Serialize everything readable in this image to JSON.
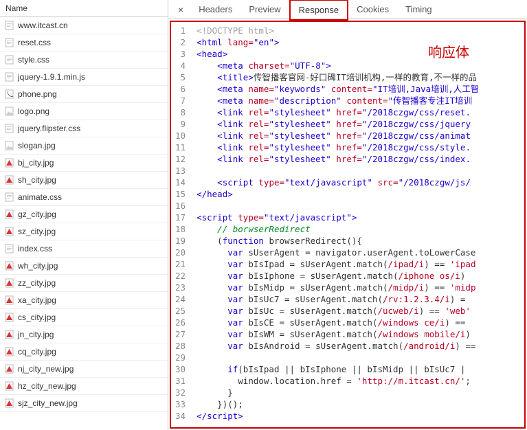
{
  "left": {
    "header": "Name",
    "files": [
      {
        "name": "www.itcast.cn",
        "type": "doc"
      },
      {
        "name": "reset.css",
        "type": "css"
      },
      {
        "name": "style.css",
        "type": "css"
      },
      {
        "name": "jquery-1.9.1.min.js",
        "type": "js"
      },
      {
        "name": "phone.png",
        "type": "png-phone"
      },
      {
        "name": "logo.png",
        "type": "png"
      },
      {
        "name": "jquery.flipster.css",
        "type": "css"
      },
      {
        "name": "slogan.jpg",
        "type": "jpg"
      },
      {
        "name": "bj_city.jpg",
        "type": "jpg-warn"
      },
      {
        "name": "sh_city.jpg",
        "type": "jpg-warn"
      },
      {
        "name": "animate.css",
        "type": "css"
      },
      {
        "name": "gz_city.jpg",
        "type": "jpg-warn"
      },
      {
        "name": "sz_city.jpg",
        "type": "jpg-warn"
      },
      {
        "name": "index.css",
        "type": "css"
      },
      {
        "name": "wh_city.jpg",
        "type": "jpg-warn"
      },
      {
        "name": "zz_city.jpg",
        "type": "jpg-warn"
      },
      {
        "name": "xa_city.jpg",
        "type": "jpg-warn"
      },
      {
        "name": "cs_city.jpg",
        "type": "jpg-warn"
      },
      {
        "name": "jn_city.jpg",
        "type": "jpg-warn"
      },
      {
        "name": "cq_city.jpg",
        "type": "jpg-warn"
      },
      {
        "name": "nj_city_new.jpg",
        "type": "jpg-warn"
      },
      {
        "name": "hz_city_new.jpg",
        "type": "jpg-warn"
      },
      {
        "name": "sjz_city_new.jpg",
        "type": "jpg-warn"
      }
    ]
  },
  "tabs": {
    "items": [
      "Headers",
      "Preview",
      "Response",
      "Cookies",
      "Timing"
    ],
    "active": "Response",
    "close": "×"
  },
  "annotation": "响应体",
  "code": {
    "lines": [
      {
        "n": 1,
        "html": "<span class='c-gray'>&lt;!DOCTYPE html&gt;</span>"
      },
      {
        "n": 2,
        "html": "<span class='c-blue'>&lt;html</span> <span class='c-red'>lang=</span><span class='c-blue'>\"en\"</span><span class='c-blue'>&gt;</span>"
      },
      {
        "n": 3,
        "html": "<span class='c-blue'>&lt;head&gt;</span>"
      },
      {
        "n": 4,
        "html": "    <span class='c-blue'>&lt;meta</span> <span class='c-red'>charset=</span><span class='c-blue'>\"UTF-8\"</span><span class='c-blue'>&gt;</span>"
      },
      {
        "n": 5,
        "html": "    <span class='c-blue'>&lt;title&gt;</span>传智播客官网-好口碑IT培训机构,一样的教育,不一样的品"
      },
      {
        "n": 6,
        "html": "    <span class='c-blue'>&lt;meta</span> <span class='c-red'>name=</span><span class='c-blue'>\"keywords\"</span> <span class='c-red'>content=</span><span class='c-blue'>\"IT培训,Java培训,人工智</span>"
      },
      {
        "n": 7,
        "html": "    <span class='c-blue'>&lt;meta</span> <span class='c-red'>name=</span><span class='c-blue'>\"description\"</span> <span class='c-red'>content=</span><span class='c-blue'>\"传智播客专注IT培训</span>"
      },
      {
        "n": 8,
        "html": "    <span class='c-blue'>&lt;link</span> <span class='c-red'>rel=</span><span class='c-blue'>\"stylesheet\"</span> <span class='c-red'>href=</span><span class='c-blue'>\"/2018czgw/css/reset.</span>"
      },
      {
        "n": 9,
        "html": "    <span class='c-blue'>&lt;link</span> <span class='c-red'>rel=</span><span class='c-blue'>\"stylesheet\"</span> <span class='c-red'>href=</span><span class='c-blue'>\"/2018czgw/css/jquery</span>"
      },
      {
        "n": 10,
        "html": "    <span class='c-blue'>&lt;link</span> <span class='c-red'>rel=</span><span class='c-blue'>\"stylesheet\"</span> <span class='c-red'>href=</span><span class='c-blue'>\"/2018czgw/css/animat</span>"
      },
      {
        "n": 11,
        "html": "    <span class='c-blue'>&lt;link</span> <span class='c-red'>rel=</span><span class='c-blue'>\"stylesheet\"</span> <span class='c-red'>href=</span><span class='c-blue'>\"/2018czgw/css/style.</span>"
      },
      {
        "n": 12,
        "html": "    <span class='c-blue'>&lt;link</span> <span class='c-red'>rel=</span><span class='c-blue'>\"stylesheet\"</span> <span class='c-red'>href=</span><span class='c-blue'>\"/2018czgw/css/index.</span>"
      },
      {
        "n": 13,
        "html": ""
      },
      {
        "n": 14,
        "html": "    <span class='c-blue'>&lt;script</span> <span class='c-red'>type=</span><span class='c-blue'>\"text/javascript\"</span> <span class='c-red'>src=</span><span class='c-blue'>\"/2018czgw/js/</span>"
      },
      {
        "n": 15,
        "html": "<span class='c-blue'>&lt;/head&gt;</span>"
      },
      {
        "n": 16,
        "html": ""
      },
      {
        "n": 17,
        "html": "<span class='c-blue'>&lt;script</span> <span class='c-red'>type=</span><span class='c-blue'>\"text/javascript\"</span><span class='c-blue'>&gt;</span>"
      },
      {
        "n": 18,
        "html": "    <span class='c-green'>// borwserRedirect</span>"
      },
      {
        "n": 19,
        "html": "    (<span class='c-kw'>function</span> browserRedirect(){"
      },
      {
        "n": 20,
        "html": "      <span class='c-kw'>var</span> sUserAgent = navigator.userAgent.toLowerCase"
      },
      {
        "n": 21,
        "html": "      <span class='c-kw'>var</span> bIsIpad = sUserAgent.match(<span class='c-str'>/ipad/i</span>) == <span class='c-str'>'ipad</span>"
      },
      {
        "n": 22,
        "html": "      <span class='c-kw'>var</span> bIsIphone = sUserAgent.match(<span class='c-str'>/iphone os/i</span>)"
      },
      {
        "n": 23,
        "html": "      <span class='c-kw'>var</span> bIsMidp = sUserAgent.match(<span class='c-str'>/midp/i</span>) == <span class='c-str'>'midp</span>"
      },
      {
        "n": 24,
        "html": "      <span class='c-kw'>var</span> bIsUc7 = sUserAgent.match(<span class='c-str'>/rv:1.2.3.4/i</span>) ="
      },
      {
        "n": 25,
        "html": "      <span class='c-kw'>var</span> bIsUc = sUserAgent.match(<span class='c-str'>/ucweb/i</span>) == <span class='c-str'>'web'</span>"
      },
      {
        "n": 26,
        "html": "      <span class='c-kw'>var</span> bIsCE = sUserAgent.match(<span class='c-str'>/windows ce/i</span>) =="
      },
      {
        "n": 27,
        "html": "      <span class='c-kw'>var</span> bIsWM = sUserAgent.match(<span class='c-str'>/windows mobile/i</span>)"
      },
      {
        "n": 28,
        "html": "      <span class='c-kw'>var</span> bIsAndroid = sUserAgent.match(<span class='c-str'>/android/i</span>) =="
      },
      {
        "n": 29,
        "html": ""
      },
      {
        "n": 30,
        "html": "      <span class='c-kw'>if</span>(bIsIpad || bIsIphone || bIsMidp || bIsUc7 |"
      },
      {
        "n": 31,
        "html": "        window.location.href = <span class='c-str'>'http://m.itcast.cn/'</span>;"
      },
      {
        "n": 32,
        "html": "      }"
      },
      {
        "n": 33,
        "html": "    })();"
      },
      {
        "n": 34,
        "html": "<span class='c-blue'>&lt;/script&gt;</span>"
      }
    ]
  },
  "icons": {
    "doc": "📄",
    "css": "📄",
    "js": "📄",
    "png": "🖼",
    "png-phone": "📞",
    "jpg": "🖼",
    "jpg-warn": "🔺"
  }
}
